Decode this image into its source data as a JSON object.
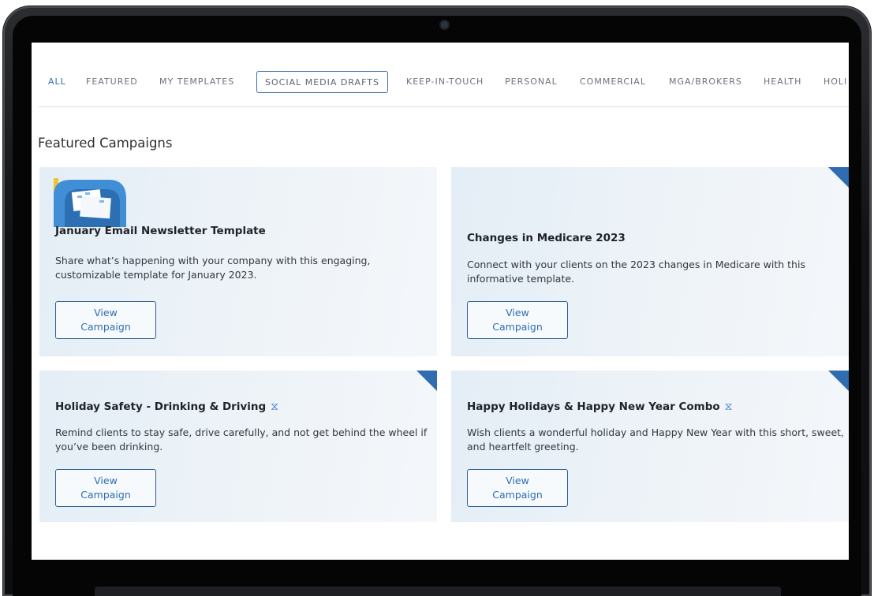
{
  "tabs": [
    {
      "label": "ALL",
      "state": "active"
    },
    {
      "label": "FEATURED"
    },
    {
      "label": "MY TEMPLATES"
    },
    {
      "label": "SOCIAL MEDIA DRAFTS",
      "state": "outlined"
    },
    {
      "label": "KEEP-IN-TOUCH"
    },
    {
      "label": "PERSONAL"
    },
    {
      "label": "COMMERCIAL"
    },
    {
      "label": "MGA/BROKERS"
    },
    {
      "label": "HEALTH"
    },
    {
      "label": "HOLI"
    }
  ],
  "section_title": "Featured Campaigns",
  "cards": [
    {
      "title": "January Email Newsletter Template",
      "description": "Share what’s happening with your company with this engaging, customizable template for January 2023.",
      "button_line1": "View",
      "button_line2": "Campaign",
      "has_illustration": true
    },
    {
      "title": "Changes in Medicare 2023",
      "description": "Connect with your clients on the 2023 changes in Medicare with this informative template.",
      "button_line1": "View",
      "button_line2": "Campaign",
      "corner_flag": true
    },
    {
      "title": "Holiday Safety - Drinking & Driving",
      "title_icon": "hourglass-icon",
      "description": "Remind clients to stay safe, drive carefully, and not get behind the wheel if you’ve been drinking.",
      "button_line1": "View",
      "button_line2": "Campaign",
      "corner_flag": true
    },
    {
      "title": "Happy Holidays & Happy New Year Combo",
      "title_icon": "hourglass-icon",
      "description": "Wish clients a wonderful holiday and Happy New Year with this short, sweet, and heartfelt greeting.",
      "button_line1": "View",
      "button_line2": "Campaign",
      "corner_flag": true
    }
  ],
  "colors": {
    "accent": "#2f6db0",
    "card_bg": "#e8f0f7",
    "bezel": "#111214"
  }
}
